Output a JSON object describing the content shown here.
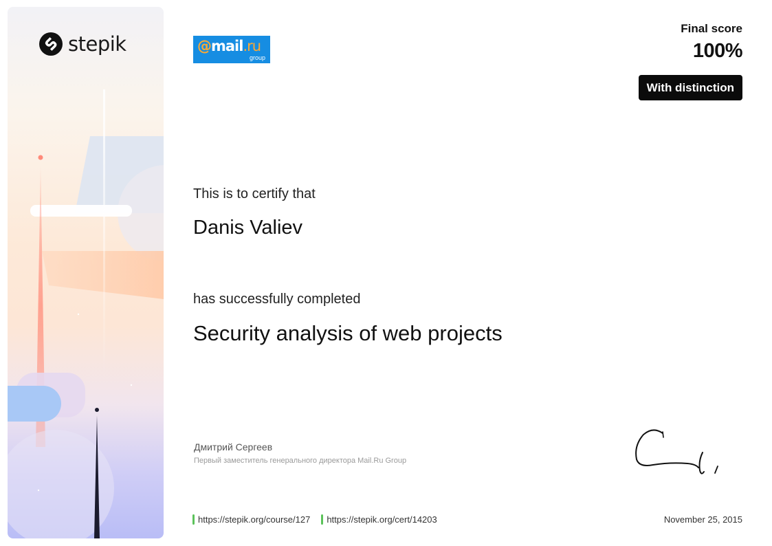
{
  "brand": {
    "name": "stepik",
    "icon": "stepik-logo-icon"
  },
  "partner": {
    "at": "@",
    "main": "mail",
    "dot_ru": ".ru",
    "sub": "group",
    "color": "#168de2"
  },
  "score": {
    "label": "Final score",
    "value": "100%",
    "badge": "With distinction"
  },
  "certificate": {
    "certify_text": "This is to certify that",
    "recipient": "Danis Valiev",
    "completed_text": "has successfully completed",
    "course_title": "Security analysis of web projects"
  },
  "signer": {
    "name": "Дмитрий Сергеев",
    "title": "Первый заместитель генерального директора Mail.Ru Group"
  },
  "links": {
    "course_url": "https://stepik.org/course/127",
    "cert_url": "https://stepik.org/cert/14203"
  },
  "issue_date": "November 25, 2015",
  "colors": {
    "accent_link_bar": "#5bc25a",
    "badge_bg": "#0b0b0b"
  }
}
